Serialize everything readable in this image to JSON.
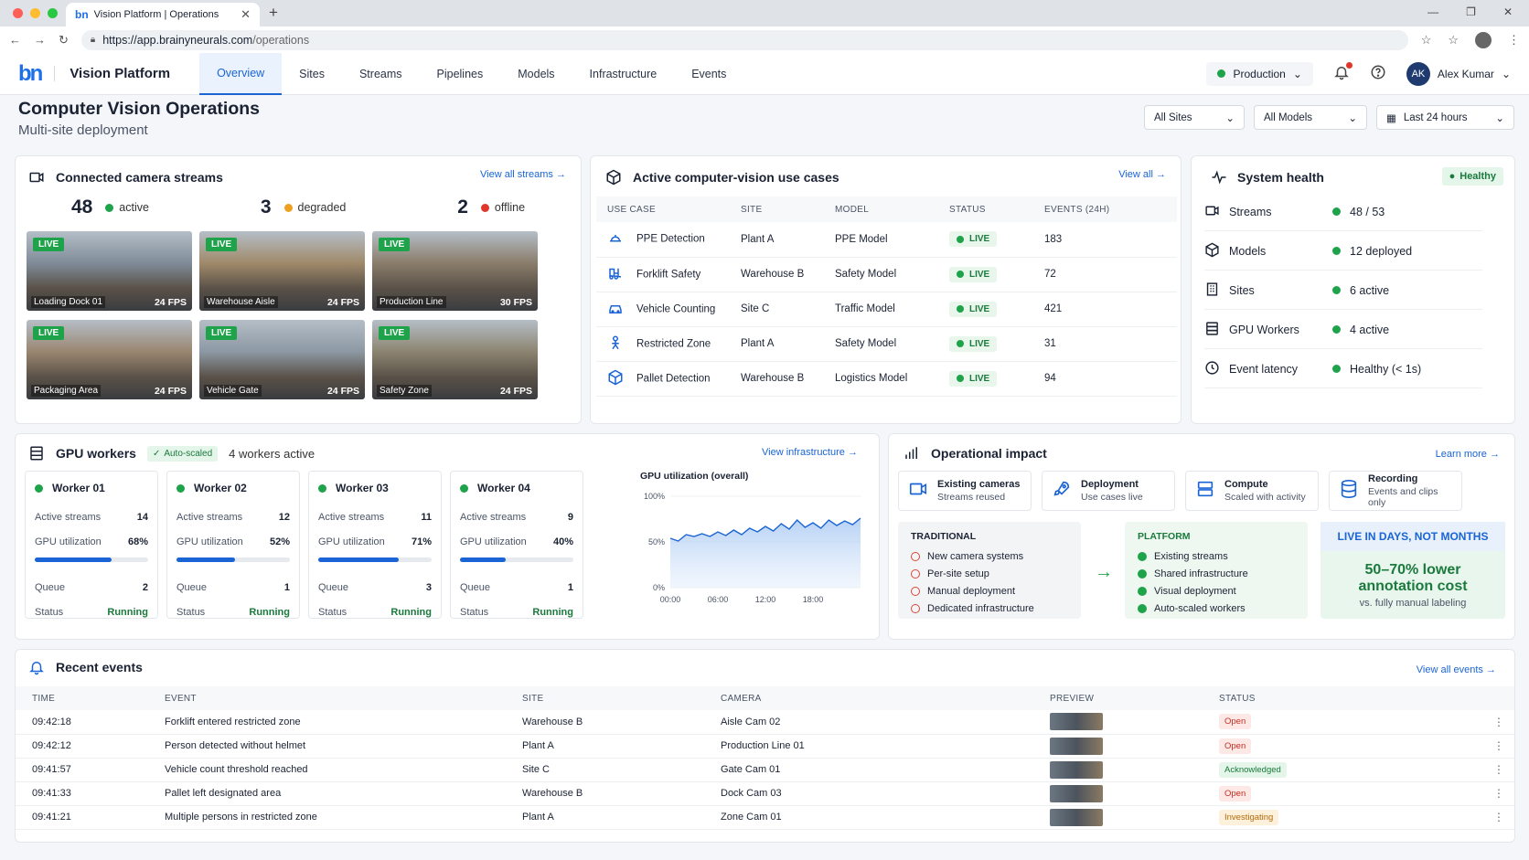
{
  "browser": {
    "tab_title": "Vision Platform | Operations",
    "url_host": "https://app.brainyneurals.com",
    "url_path": "/operations"
  },
  "app": {
    "logo_text": "bn",
    "brand": "Vision Platform"
  },
  "nav": {
    "tabs": [
      "Overview",
      "Sites",
      "Streams",
      "Pipelines",
      "Models",
      "Infrastructure",
      "Events"
    ],
    "active": "Overview"
  },
  "header": {
    "environment": "Production",
    "user_initials": "AK",
    "user_name": "Alex Kumar"
  },
  "page": {
    "title": "Computer Vision Operations",
    "subtitle": "Multi-site deployment"
  },
  "filters": {
    "sites": "All Sites",
    "models": "All Models",
    "range": "Last 24 hours"
  },
  "streams": {
    "title": "Connected camera streams",
    "link": "View all streams",
    "counts": [
      {
        "n": "48",
        "label": "active",
        "color": "#1fa34a"
      },
      {
        "n": "3",
        "label": "degraded",
        "color": "#f0a020"
      },
      {
        "n": "2",
        "label": "offline",
        "color": "#e0352b"
      }
    ],
    "live_label": "LIVE",
    "cameras": [
      {
        "name": "Loading Dock 01",
        "fps": "24 FPS"
      },
      {
        "name": "Warehouse Aisle",
        "fps": "24 FPS"
      },
      {
        "name": "Production Line",
        "fps": "30 FPS"
      },
      {
        "name": "Packaging Area",
        "fps": "24 FPS"
      },
      {
        "name": "Vehicle Gate",
        "fps": "24 FPS"
      },
      {
        "name": "Safety Zone",
        "fps": "24 FPS"
      }
    ]
  },
  "usecases": {
    "title": "Active computer-vision use cases",
    "link": "View all",
    "columns": [
      "USE CASE",
      "SITE",
      "MODEL",
      "STATUS",
      "EVENTS (24H)"
    ],
    "rows": [
      {
        "icon": "hard-hat-icon",
        "name": "PPE Detection",
        "site": "Plant A",
        "model": "PPE Model",
        "status": "LIVE",
        "events": "183"
      },
      {
        "icon": "forklift-icon",
        "name": "Forklift Safety",
        "site": "Warehouse B",
        "model": "Safety Model",
        "status": "LIVE",
        "events": "72"
      },
      {
        "icon": "car-icon",
        "name": "Vehicle Counting",
        "site": "Site C",
        "model": "Traffic Model",
        "status": "LIVE",
        "events": "421"
      },
      {
        "icon": "person-icon",
        "name": "Restricted Zone",
        "site": "Plant A",
        "model": "Safety Model",
        "status": "LIVE",
        "events": "31"
      },
      {
        "icon": "box-icon",
        "name": "Pallet Detection",
        "site": "Warehouse B",
        "model": "Logistics Model",
        "status": "LIVE",
        "events": "94"
      }
    ]
  },
  "health": {
    "title": "System health",
    "badge": "Healthy",
    "rows": [
      {
        "icon": "camera-icon",
        "label": "Streams",
        "value": "48 / 53"
      },
      {
        "icon": "cube-icon",
        "label": "Models",
        "value": "12 deployed"
      },
      {
        "icon": "building-icon",
        "label": "Sites",
        "value": "6 active"
      },
      {
        "icon": "server-icon",
        "label": "GPU Workers",
        "value": "4 active"
      },
      {
        "icon": "clock-icon",
        "label": "Event latency",
        "value": "Healthy (< 1s)"
      }
    ]
  },
  "gpu": {
    "title": "GPU workers",
    "badge": "Auto-scaled",
    "summary": "4 workers active",
    "link": "View infrastructure",
    "labels": {
      "streams": "Active streams",
      "util": "GPU utilization",
      "queue": "Queue",
      "status": "Status"
    },
    "workers": [
      {
        "name": "Worker 01",
        "streams": "14",
        "util": "68%",
        "util_frac": 0.68,
        "queue": "2",
        "status": "Running"
      },
      {
        "name": "Worker 02",
        "streams": "12",
        "util": "52%",
        "util_frac": 0.52,
        "queue": "1",
        "status": "Running"
      },
      {
        "name": "Worker 03",
        "streams": "11",
        "util": "71%",
        "util_frac": 0.71,
        "queue": "3",
        "status": "Running"
      },
      {
        "name": "Worker 04",
        "streams": "9",
        "util": "40%",
        "util_frac": 0.4,
        "queue": "1",
        "status": "Running"
      }
    ]
  },
  "chart_data": {
    "type": "area",
    "title": "GPU utilization (overall)",
    "ylim": [
      0,
      100
    ],
    "yticks": [
      "100%",
      "50%",
      "0%"
    ],
    "xticks": [
      "00:00",
      "06:00",
      "12:00",
      "18:00"
    ],
    "xlim": [
      0,
      24
    ],
    "x": [
      0,
      1,
      2,
      3,
      4,
      5,
      6,
      7,
      8,
      9,
      10,
      11,
      12,
      13,
      14,
      15,
      16,
      17,
      18,
      19,
      20,
      21,
      22,
      23,
      24
    ],
    "values": [
      54,
      51,
      58,
      56,
      59,
      56,
      61,
      57,
      63,
      58,
      65,
      61,
      67,
      62,
      70,
      64,
      74,
      66,
      71,
      65,
      74,
      68,
      73,
      69,
      76
    ]
  },
  "impact": {
    "title": "Operational impact",
    "link": "Learn more",
    "tiles": [
      {
        "icon": "camera-icon",
        "title": "Existing cameras",
        "sub": "Streams reused"
      },
      {
        "icon": "rocket-icon",
        "title": "Deployment",
        "sub": "Use cases live"
      },
      {
        "icon": "server-icon",
        "title": "Compute",
        "sub": "Scaled with activity"
      },
      {
        "icon": "database-icon",
        "title": "Recording",
        "sub": "Events and clips only"
      }
    ],
    "traditional": {
      "heading": "TRADITIONAL",
      "items": [
        "New camera systems",
        "Per-site setup",
        "Manual deployment",
        "Dedicated infrastructure"
      ]
    },
    "platform": {
      "heading": "PLATFORM",
      "items": [
        "Existing streams",
        "Shared infrastructure",
        "Visual deployment",
        "Auto-scaled workers"
      ]
    },
    "callout": {
      "heading": "LIVE IN DAYS, NOT MONTHS",
      "line1": "50–70% lower",
      "line2": "annotation cost",
      "note": "vs. fully manual labeling"
    }
  },
  "events": {
    "title": "Recent events",
    "link": "View all events",
    "columns": [
      "TIME",
      "EVENT",
      "SITE",
      "CAMERA",
      "PREVIEW",
      "STATUS"
    ],
    "rows": [
      {
        "time": "09:42:18",
        "event": "Forklift entered restricted zone",
        "site": "Warehouse B",
        "camera": "Aisle Cam 02",
        "status": "Open",
        "kind": "open"
      },
      {
        "time": "09:42:12",
        "event": "Person detected without helmet",
        "site": "Plant A",
        "camera": "Production Line 01",
        "status": "Open",
        "kind": "open"
      },
      {
        "time": "09:41:57",
        "event": "Vehicle count threshold reached",
        "site": "Site C",
        "camera": "Gate Cam 01",
        "status": "Acknowledged",
        "kind": "ack"
      },
      {
        "time": "09:41:33",
        "event": "Pallet left designated area",
        "site": "Warehouse B",
        "camera": "Dock Cam 03",
        "status": "Open",
        "kind": "open"
      },
      {
        "time": "09:41:21",
        "event": "Multiple persons in restricted zone",
        "site": "Plant A",
        "camera": "Zone Cam 01",
        "status": "Investigating",
        "kind": "inv"
      }
    ]
  }
}
